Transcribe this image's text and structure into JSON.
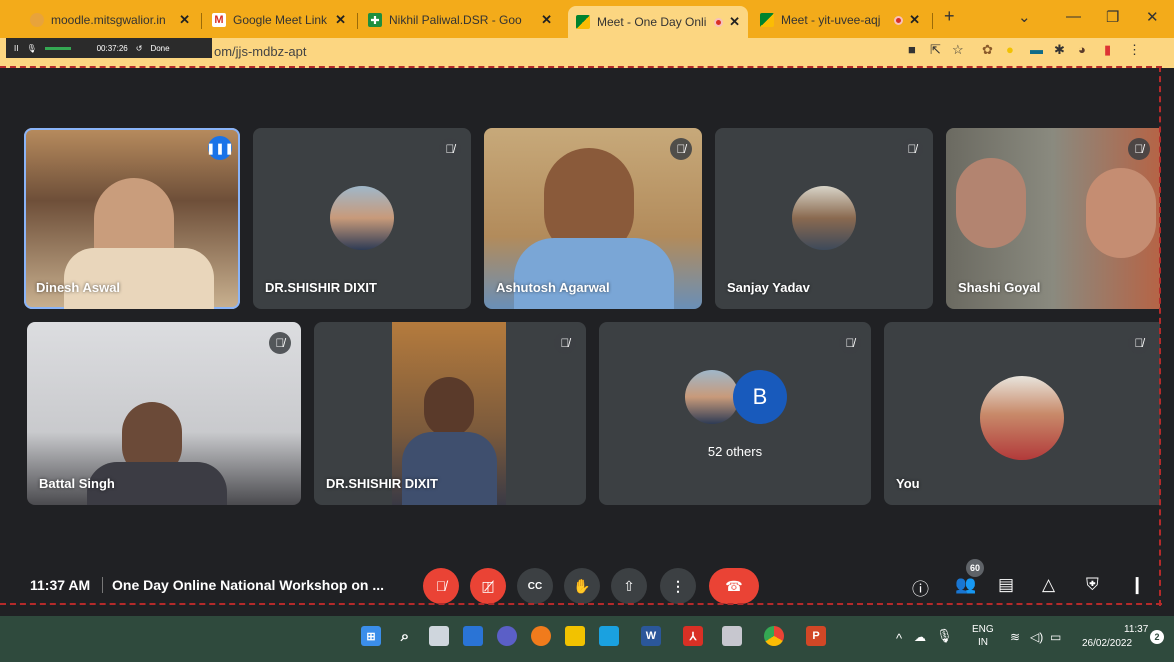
{
  "browser": {
    "tabs": [
      {
        "title": "moodle.mitsgwalior.in",
        "favicon_color": "#e8a33b"
      },
      {
        "title": "Google Meet Link for Joi",
        "favicon_color": "#d93025"
      },
      {
        "title": "Nikhil Paliwal.DSR - Goo",
        "favicon_color": "#1e8e3e"
      },
      {
        "title": "Meet - One Day Onli",
        "favicon_color": "#00832d"
      },
      {
        "title": "Meet - yit-uvee-aqj",
        "favicon_color": "#00832d"
      }
    ],
    "new_tab": "+",
    "close_glyph": "✕",
    "url": "om/jjs-mdbz-apt",
    "window_controls": [
      "⌄",
      "—",
      "❐",
      "✕"
    ]
  },
  "recorder": {
    "pause": "II",
    "time": "00:37:26",
    "done": "Done"
  },
  "tiles": [
    {
      "name": "Dinesh Aswal",
      "muted": false,
      "speaking": true
    },
    {
      "name": "DR.SHISHIR DIXIT",
      "muted": true
    },
    {
      "name": "Ashutosh Agarwal",
      "muted": true
    },
    {
      "name": "Sanjay Yadav",
      "muted": true
    },
    {
      "name": "Shashi Goyal",
      "muted": true
    },
    {
      "name": "Battal Singh",
      "muted": true
    },
    {
      "name": "DR.SHISHIR DIXIT",
      "muted": true
    },
    {
      "name": "52 others",
      "avatar_letter": "B",
      "muted": true
    },
    {
      "name": "You",
      "muted": true
    }
  ],
  "bottom": {
    "time": "11:37 AM",
    "meeting_title": "One Day Online National Workshop on ...",
    "participants_count": "60",
    "cc_label": "CC"
  },
  "taskbar": {
    "lang_top": "ENG",
    "lang_bottom": "IN",
    "clock_time": "11:37",
    "clock_date": "26/02/2022",
    "notification_count": "2",
    "word_label": "W",
    "ppt_label": "P"
  },
  "colors": {
    "chrome_accent": "#f3ab1a",
    "meet_bg": "#202124",
    "tile_bg": "#3c4043",
    "red": "#ea4335",
    "taskbar": "#2f4a3d"
  }
}
